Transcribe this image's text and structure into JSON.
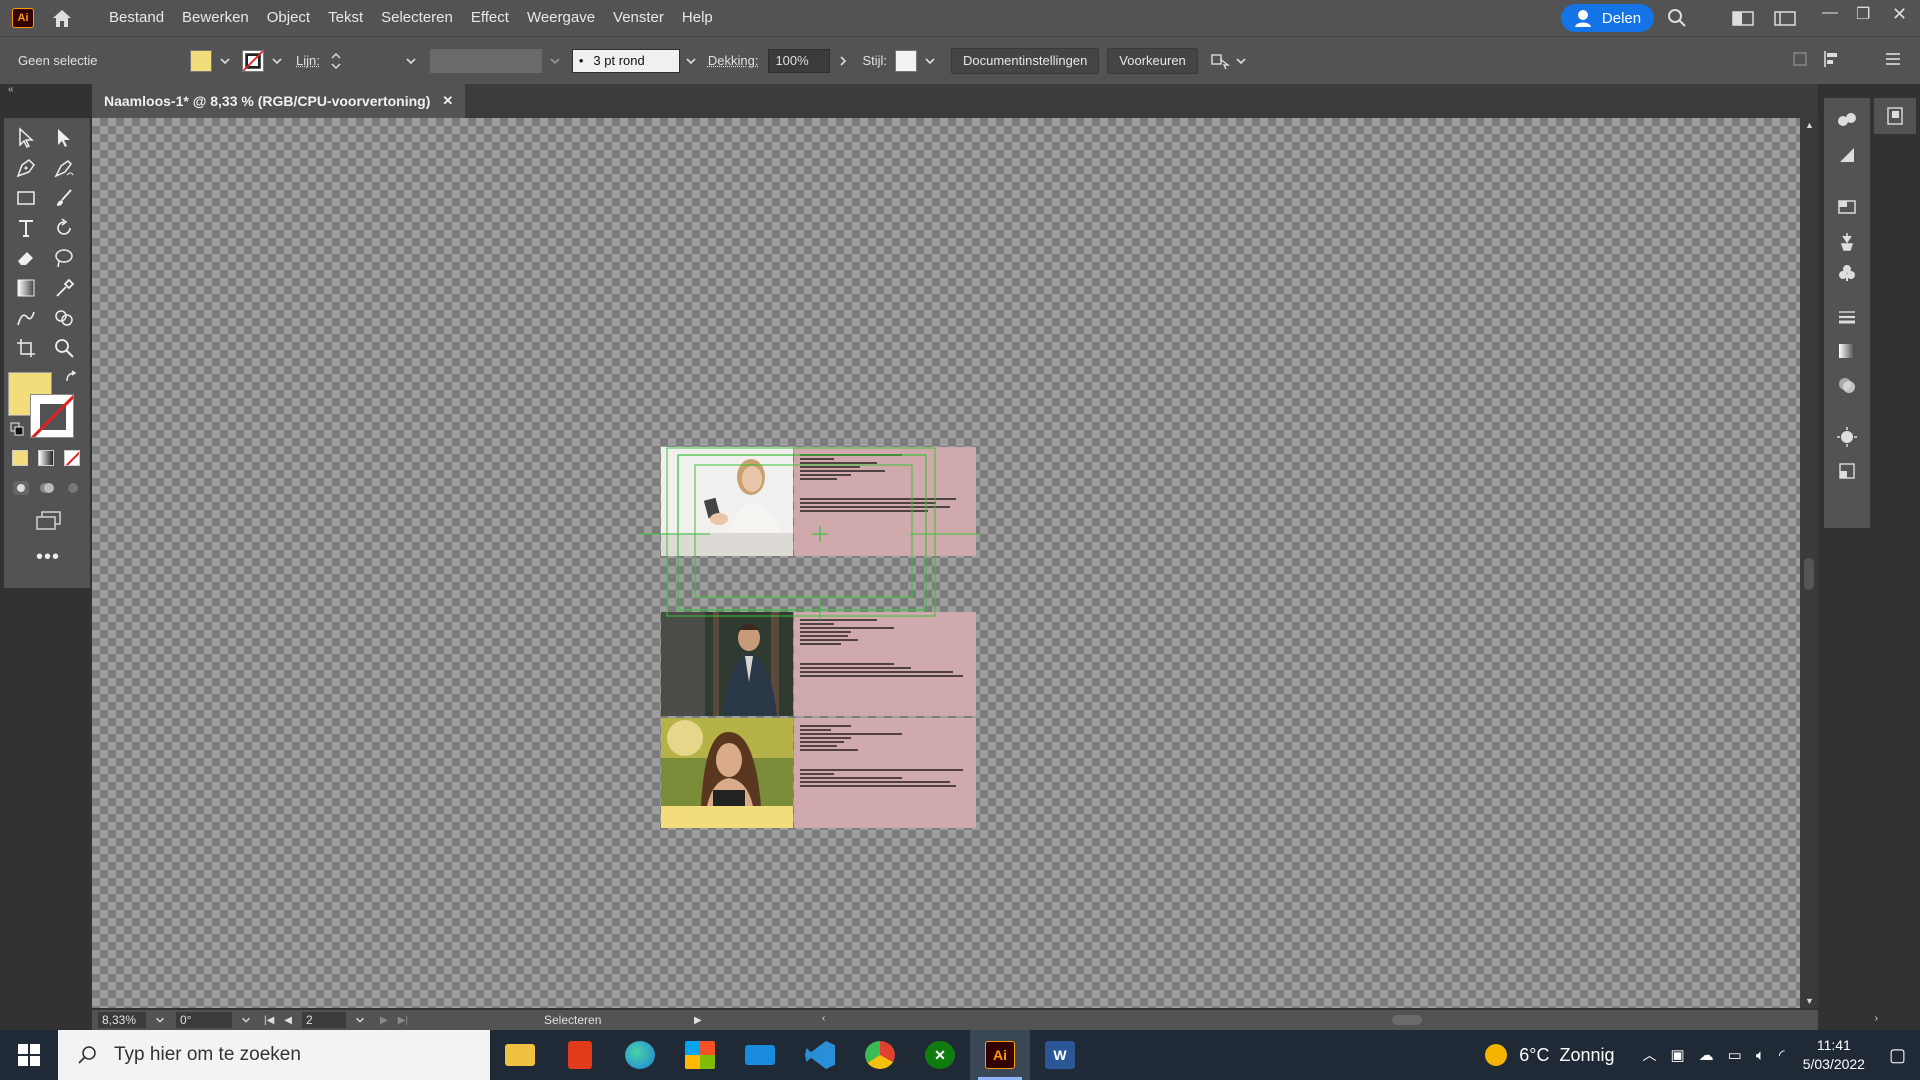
{
  "menubar": {
    "logo": "Ai",
    "items": [
      "Bestand",
      "Bewerken",
      "Object",
      "Tekst",
      "Selecteren",
      "Effect",
      "Weergave",
      "Venster",
      "Help"
    ],
    "share_label": "Delen"
  },
  "controlbar": {
    "selection_label": "Geen selectie",
    "stroke_label": "Lijn:",
    "brush_value": "3 pt rond",
    "opacity_label": "Dekking:",
    "opacity_value": "100%",
    "style_label": "Stijl:",
    "doc_settings_label": "Documentinstellingen",
    "preferences_label": "Voorkeuren",
    "fill_color": "#f3dc7c"
  },
  "document": {
    "tab_title": "Naamloos-1* @ 8,33 % (RGB/CPU-voorvertoning)",
    "close_glyph": "✕"
  },
  "statusbar": {
    "zoom": "8,33%",
    "rotation": "0°",
    "artboard_number": "2",
    "tool_status": "Selecteren"
  },
  "taskbar": {
    "search_placeholder": "Typ hier om te zoeken",
    "apps": [
      "file-explorer",
      "office",
      "edge",
      "store",
      "mail",
      "vscode",
      "google-chrome",
      "xbox",
      "illustrator",
      "word"
    ],
    "illustrator_label": "Ai",
    "word_label": "W",
    "weather": "6°C  Zonnig",
    "time": "11:41",
    "date": "5/03/2022"
  },
  "colors": {
    "accent": "#1473e6",
    "card_pink": "#cfa9ab",
    "fill_yellow": "#f3dc7c",
    "guide_green": "#39c23a"
  }
}
